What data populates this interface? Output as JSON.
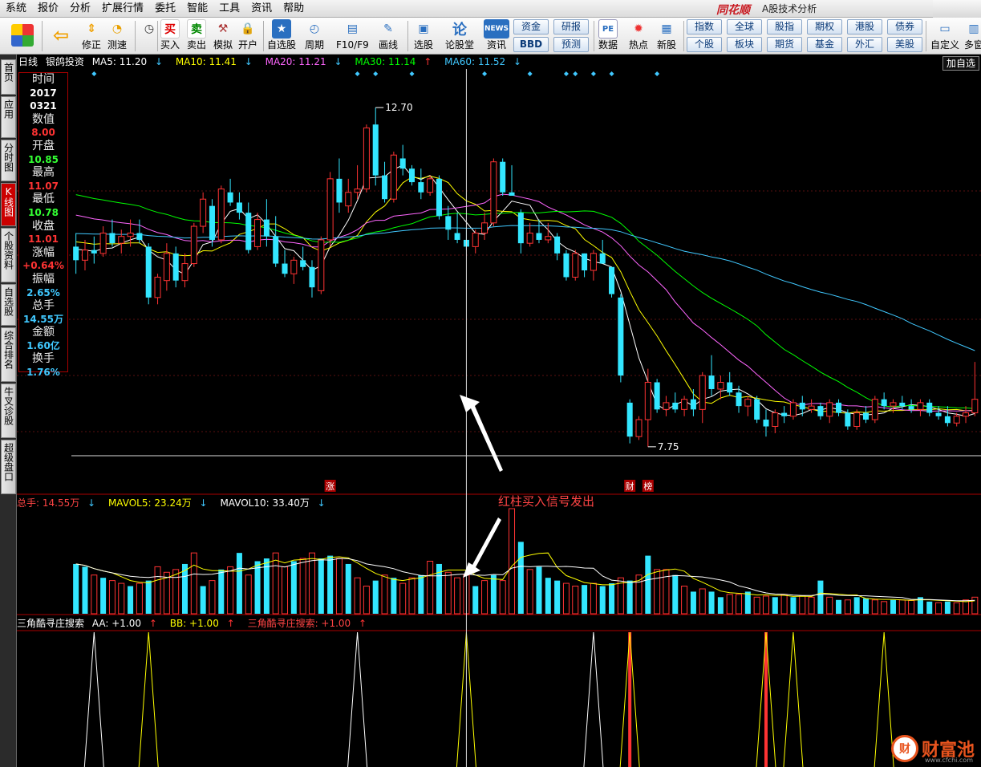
{
  "menu": {
    "items": [
      "系统",
      "报价",
      "分析",
      "扩展行情",
      "委托",
      "智能",
      "工具",
      "资讯",
      "帮助"
    ],
    "brand": "同花顺",
    "app_title": "A股技术分析"
  },
  "toolbar": {
    "buttons": [
      "修正",
      "测速",
      "买入",
      "卖出",
      "模拟",
      "开户",
      "自选股",
      "周期",
      "F10/F9",
      "画线",
      "选股",
      "论股堂",
      "资讯",
      "数据",
      "热点",
      "新股",
      "自定义",
      "多窗"
    ],
    "icon_text": {
      "buy": "买",
      "sell": "卖",
      "news": "NEWS",
      "lun": "论",
      "pe": "PE"
    },
    "grid1": [
      "资金",
      "研报",
      "BBD",
      "预测"
    ],
    "grid2": [
      "指数",
      "全球",
      "股指",
      "期权",
      "港股",
      "债券",
      "个股",
      "板块",
      "期货",
      "基金",
      "外汇",
      "美股"
    ]
  },
  "sidebar": {
    "tabs": [
      "首页",
      "应用",
      "分时图",
      "K线图",
      "个股资料",
      "自选股",
      "综合排名",
      "牛叉诊股",
      "超级盘口"
    ],
    "active": "K线图"
  },
  "kline_header": {
    "period": "日线",
    "stock": "银鸽投资",
    "ma": [
      {
        "label": "MA5: 11.20",
        "arrow": "↓",
        "color": "#ffffff"
      },
      {
        "label": "MA10: 11.41",
        "arrow": "↓",
        "color": "#ffff00"
      },
      {
        "label": "MA20: 11.21",
        "arrow": "↓",
        "color": "#ff66ff"
      },
      {
        "label": "MA30: 11.14",
        "arrow": "↑",
        "color": "#00ff00"
      },
      {
        "label": "MA60: 11.52",
        "arrow": "↓",
        "color": "#40c8ff"
      }
    ],
    "add_favorite": "加自选"
  },
  "info_panel": [
    {
      "key": "时间",
      "value": "2017",
      "color": "#ffffff"
    },
    {
      "key": "",
      "value": "0321",
      "color": "#ffffff"
    },
    {
      "key": "数值",
      "value": "8.00",
      "color": "#ff3333"
    },
    {
      "key": "开盘",
      "value": "10.85",
      "color": "#33ff33"
    },
    {
      "key": "最高",
      "value": "11.07",
      "color": "#ff3333"
    },
    {
      "key": "最低",
      "value": "10.78",
      "color": "#33ff33"
    },
    {
      "key": "收盘",
      "value": "11.01",
      "color": "#ff3333"
    },
    {
      "key": "涨幅",
      "value": "+0.64%",
      "color": "#ff3333"
    },
    {
      "key": "振幅",
      "value": "2.65%",
      "color": "#40c8ff"
    },
    {
      "key": "总手",
      "value": "14.55万",
      "color": "#40c8ff"
    },
    {
      "key": "金额",
      "value": "1.60亿",
      "color": "#40c8ff"
    },
    {
      "key": "换手",
      "value": "1.76%",
      "color": "#40c8ff"
    }
  ],
  "annotations": {
    "high": "12.70",
    "low": "7.75",
    "tags": [
      "涨",
      "财",
      "榜"
    ],
    "signal_text": "红柱买入信号发出"
  },
  "volume_header": {
    "items": [
      {
        "label": "总手: 14.55万",
        "arrow": "↓",
        "color": "#ff4444"
      },
      {
        "label": "MAVOL5: 23.24万",
        "arrow": "↓",
        "color": "#ffff00"
      },
      {
        "label": "MAVOL10: 33.40万",
        "arrow": "↓",
        "color": "#ffffff"
      }
    ]
  },
  "indicator_header": {
    "items": [
      {
        "label": "三角酷寻庄搜索",
        "arrow": "",
        "color": "#ffffff"
      },
      {
        "label": "AA: +1.00",
        "arrow": "↑",
        "color": "#ffffff"
      },
      {
        "label": "BB: +1.00",
        "arrow": "↑",
        "color": "#ffff00"
      },
      {
        "label": "三角酷寻庄搜索: +1.00",
        "arrow": "↑",
        "color": "#ff4444"
      }
    ]
  },
  "watermark": {
    "logo": "财",
    "text": "财富池",
    "url": "www.cfchi.com"
  },
  "colors": {
    "up": "#ff3333",
    "down": "#33e6ff",
    "ma5": "#ffffff",
    "ma10": "#ffff00",
    "ma20": "#ff66ff",
    "ma30": "#00ff00",
    "ma60": "#40c8ff"
  },
  "chart_data": {
    "type": "candlestick",
    "price_range": [
      7.5,
      13.2
    ],
    "candles": [
      [
        10.7,
        10.9,
        10.3,
        10.5
      ],
      [
        10.5,
        10.8,
        10.35,
        10.65
      ],
      [
        10.65,
        10.85,
        10.45,
        10.6
      ],
      [
        10.6,
        11.0,
        10.55,
        10.9
      ],
      [
        10.9,
        11.1,
        10.7,
        10.75
      ],
      [
        10.75,
        10.95,
        10.6,
        10.85
      ],
      [
        10.85,
        11.1,
        10.7,
        10.9
      ],
      [
        10.9,
        11.1,
        10.75,
        10.8
      ],
      [
        10.7,
        10.75,
        9.85,
        9.95
      ],
      [
        9.95,
        10.3,
        9.85,
        10.25
      ],
      [
        10.2,
        10.75,
        10.05,
        10.6
      ],
      [
        10.6,
        10.7,
        10.1,
        10.2
      ],
      [
        10.2,
        10.6,
        10.1,
        10.45
      ],
      [
        10.45,
        11.05,
        10.4,
        11.0
      ],
      [
        11.0,
        11.5,
        10.9,
        11.4
      ],
      [
        11.3,
        11.4,
        10.7,
        10.8
      ],
      [
        10.8,
        11.6,
        10.75,
        11.55
      ],
      [
        11.5,
        11.7,
        11.3,
        11.35
      ],
      [
        11.35,
        11.5,
        11.1,
        11.2
      ],
      [
        11.2,
        11.35,
        10.6,
        10.65
      ],
      [
        10.7,
        11.2,
        10.65,
        11.1
      ],
      [
        11.1,
        11.4,
        10.7,
        10.85
      ],
      [
        10.85,
        11.15,
        10.4,
        10.45
      ],
      [
        10.45,
        10.65,
        10.25,
        10.3
      ],
      [
        10.3,
        10.55,
        10.15,
        10.5
      ],
      [
        10.5,
        10.7,
        10.35,
        10.4
      ],
      [
        10.4,
        10.5,
        9.95,
        10.1
      ],
      [
        10.05,
        10.85,
        10.0,
        10.8
      ],
      [
        10.8,
        11.8,
        10.7,
        11.7
      ],
      [
        11.7,
        12.0,
        11.2,
        11.35
      ],
      [
        11.3,
        11.7,
        11.2,
        11.5
      ],
      [
        11.5,
        11.9,
        11.4,
        11.55
      ],
      [
        11.55,
        12.5,
        11.5,
        12.45
      ],
      [
        12.5,
        12.75,
        11.6,
        11.75
      ],
      [
        11.75,
        11.95,
        11.35,
        11.4
      ],
      [
        11.4,
        12.1,
        11.35,
        12.05
      ],
      [
        12.0,
        12.2,
        11.75,
        11.85
      ],
      [
        11.85,
        11.9,
        11.6,
        11.65
      ],
      [
        11.65,
        11.85,
        11.4,
        11.5
      ],
      [
        11.5,
        11.75,
        11.45,
        11.7
      ],
      [
        11.7,
        11.75,
        11.1,
        11.15
      ],
      [
        11.15,
        11.3,
        10.8,
        10.95
      ],
      [
        10.9,
        11.2,
        10.75,
        10.8
      ],
      [
        10.8,
        10.95,
        10.65,
        10.7
      ],
      [
        10.7,
        10.95,
        10.6,
        10.9
      ],
      [
        10.9,
        11.2,
        10.8,
        11.05
      ],
      [
        11.05,
        12.0,
        11.0,
        11.95
      ],
      [
        11.95,
        12.0,
        11.45,
        11.5
      ],
      [
        11.5,
        11.9,
        11.45,
        11.45
      ],
      [
        11.2,
        11.25,
        10.6,
        10.75
      ],
      [
        10.75,
        11.05,
        10.7,
        10.9
      ],
      [
        10.9,
        11.1,
        10.75,
        10.8
      ],
      [
        10.8,
        11.05,
        10.75,
        10.85
      ],
      [
        10.85,
        10.9,
        10.5,
        10.6
      ],
      [
        10.6,
        10.65,
        10.2,
        10.25
      ],
      [
        10.25,
        10.65,
        10.2,
        10.6
      ],
      [
        10.6,
        10.6,
        10.25,
        10.35
      ],
      [
        10.35,
        10.65,
        10.2,
        10.6
      ],
      [
        10.6,
        10.8,
        10.45,
        10.45
      ],
      [
        10.4,
        10.0,
        9.95,
        10.0
      ],
      [
        9.95,
        10.0,
        8.7,
        8.8
      ],
      [
        8.4,
        8.45,
        7.8,
        7.9
      ],
      [
        7.9,
        8.2,
        7.85,
        8.15
      ],
      [
        8.15,
        8.9,
        7.75,
        8.7
      ],
      [
        8.7,
        8.75,
        8.25,
        8.3
      ],
      [
        8.3,
        8.5,
        8.2,
        8.4
      ],
      [
        8.4,
        8.55,
        8.25,
        8.3
      ],
      [
        8.3,
        8.5,
        8.2,
        8.45
      ],
      [
        8.45,
        8.6,
        8.2,
        8.3
      ],
      [
        8.3,
        8.85,
        8.1,
        8.8
      ],
      [
        8.8,
        9.1,
        8.5,
        8.6
      ],
      [
        8.6,
        8.8,
        8.45,
        8.7
      ],
      [
        8.7,
        8.85,
        8.5,
        8.55
      ],
      [
        8.55,
        8.65,
        8.25,
        8.35
      ],
      [
        8.35,
        8.5,
        8.2,
        8.45
      ],
      [
        8.45,
        8.5,
        8.1,
        8.15
      ],
      [
        8.15,
        8.3,
        7.9,
        8.05
      ],
      [
        8.05,
        8.3,
        7.95,
        8.25
      ],
      [
        8.25,
        8.35,
        8.1,
        8.2
      ],
      [
        8.2,
        8.45,
        8.15,
        8.4
      ],
      [
        8.4,
        8.5,
        8.2,
        8.3
      ],
      [
        8.3,
        8.45,
        8.25,
        8.35
      ],
      [
        8.35,
        8.4,
        8.15,
        8.2
      ],
      [
        8.2,
        8.45,
        8.1,
        8.4
      ],
      [
        8.4,
        8.45,
        8.2,
        8.25
      ],
      [
        8.25,
        8.3,
        8.0,
        8.05
      ],
      [
        8.05,
        8.3,
        8.0,
        8.25
      ],
      [
        8.25,
        8.35,
        8.1,
        8.15
      ],
      [
        8.15,
        8.5,
        8.1,
        8.45
      ],
      [
        8.45,
        8.55,
        8.3,
        8.35
      ],
      [
        8.35,
        8.45,
        8.25,
        8.4
      ],
      [
        8.4,
        8.5,
        8.3,
        8.35
      ],
      [
        8.35,
        8.45,
        8.25,
        8.3
      ],
      [
        8.3,
        8.45,
        8.2,
        8.4
      ],
      [
        8.4,
        8.45,
        8.2,
        8.25
      ],
      [
        8.25,
        8.35,
        8.15,
        8.2
      ],
      [
        8.2,
        8.35,
        8.05,
        8.1
      ],
      [
        8.1,
        8.25,
        8.05,
        8.2
      ],
      [
        8.2,
        8.35,
        8.1,
        8.25
      ],
      [
        8.25,
        9.0,
        8.2,
        8.45
      ]
    ],
    "volume_range": [
      0,
      19
    ],
    "volume": [
      9,
      8.5,
      7,
      6.5,
      6,
      5.5,
      5,
      5.5,
      6,
      8.5,
      7.5,
      8,
      9,
      11,
      5,
      6,
      8,
      8.5,
      11,
      7,
      9.5,
      10,
      11,
      8.5,
      9.5,
      10,
      11,
      10,
      10.5,
      10,
      9,
      6.5,
      5,
      6,
      7,
      6.5,
      5.5,
      6.5,
      7,
      9.5,
      9,
      7.5,
      6.5,
      7,
      5,
      6,
      7,
      6,
      19,
      13,
      8,
      8.5,
      6.5,
      6,
      5.5,
      5,
      5.2,
      5.5,
      5,
      5.5,
      6.5,
      6,
      7,
      10.5,
      8,
      8,
      7,
      5,
      4,
      4.5,
      4,
      3,
      3.5,
      3.5,
      4,
      3,
      3.2,
      3,
      3.5,
      3,
      3.2,
      3,
      6,
      3,
      2.5,
      2.5,
      3,
      2.8,
      2.5,
      2.2,
      2.5,
      2.5,
      2.4,
      3,
      2.2,
      2,
      2.2,
      2,
      2.5,
      3
    ],
    "vol_up_flags": [
      0,
      0,
      1,
      0,
      1,
      1,
      0,
      1,
      0,
      1,
      1,
      1,
      0,
      1,
      0,
      1,
      0,
      1,
      0,
      1,
      0,
      0,
      1,
      1,
      0,
      1,
      1,
      0,
      0,
      1,
      0,
      1,
      1,
      0,
      1,
      0,
      1,
      1,
      0,
      1,
      0,
      1,
      1,
      1,
      0,
      1,
      0,
      1,
      1,
      0,
      1,
      0,
      0,
      0,
      1,
      1,
      0,
      1,
      0,
      0,
      1,
      0,
      1,
      0,
      1,
      1,
      0,
      1,
      0,
      1,
      0,
      0,
      1,
      1,
      0,
      1,
      1,
      0,
      1,
      0,
      1,
      1,
      0,
      1,
      0,
      1,
      0,
      0,
      1,
      1,
      0,
      1,
      1,
      0,
      0,
      1,
      0,
      1,
      1,
      1
    ],
    "signal_indices": {
      "white": [
        2,
        31,
        57
      ],
      "yellow": [
        8,
        43,
        79,
        89,
        108
      ],
      "red": [
        61,
        76
      ]
    }
  }
}
